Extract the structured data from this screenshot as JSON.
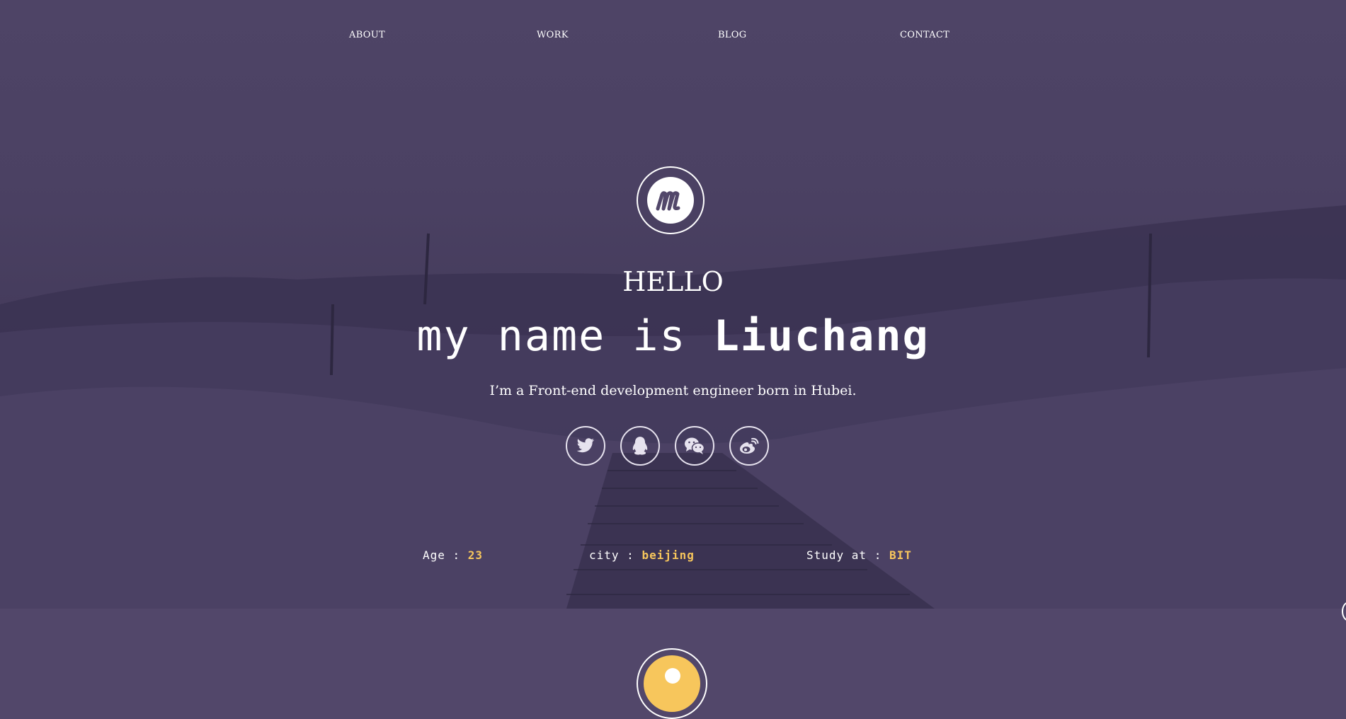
{
  "nav": {
    "items": [
      "ABOUT",
      "WORK",
      "BLOG",
      "CONTACT"
    ]
  },
  "logo": {
    "letter": "m"
  },
  "hero": {
    "greeting": "HELLO",
    "headline_prefix": "my name is ",
    "headline_name": "Liuchang",
    "tagline": "I’m a Front-end development engineer born in Hubei."
  },
  "social": [
    {
      "name": "twitter-icon"
    },
    {
      "name": "qq-icon"
    },
    {
      "name": "wechat-icon"
    },
    {
      "name": "weibo-icon"
    }
  ],
  "info": {
    "age": {
      "label": "Age : ",
      "value": "23"
    },
    "city": {
      "label": "city : ",
      "value": "beijing"
    },
    "study": {
      "label": "Study at : ",
      "value": "BIT"
    }
  },
  "colors": {
    "background": "#52476a",
    "accent": "#f7c65c",
    "text": "#ffffff"
  }
}
